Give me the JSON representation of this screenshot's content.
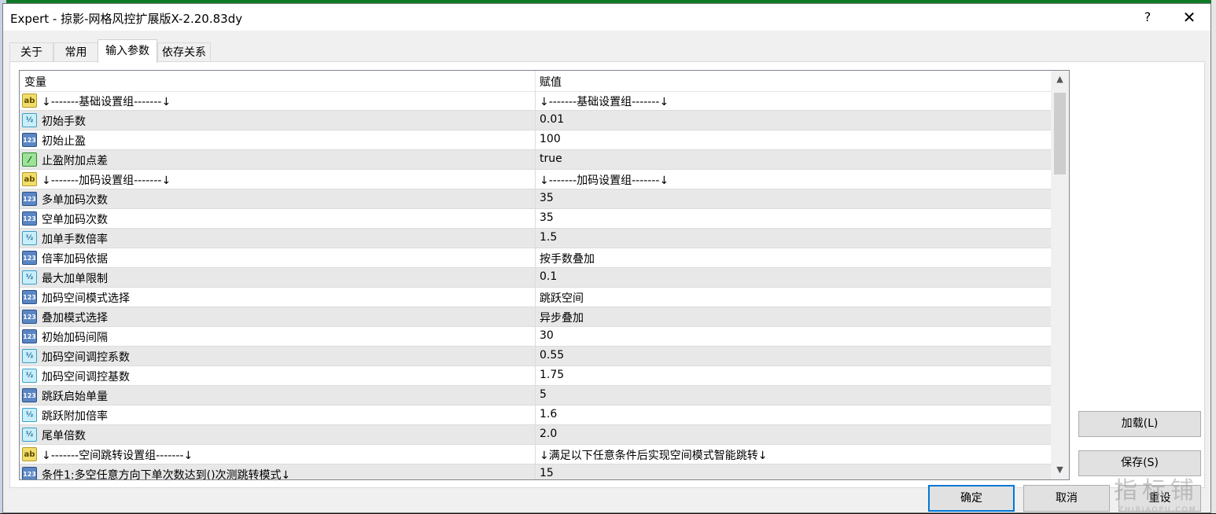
{
  "window": {
    "title": "Expert - 掠影-网格风控扩展版X-2.20.83dy",
    "help_label": "?",
    "close_label": "✕"
  },
  "tabs": [
    {
      "label": "关于"
    },
    {
      "label": "常用"
    },
    {
      "label": "输入参数"
    },
    {
      "label": "依存关系"
    }
  ],
  "active_tab": "输入参数",
  "grid": {
    "headers": {
      "variable": "变量",
      "value": "赋值"
    },
    "rows": [
      {
        "type": "ab",
        "variable": "↓-------基础设置组-------↓",
        "value": "↓-------基础设置组-------↓"
      },
      {
        "type": "½",
        "variable": "初始手数",
        "value": "0.01"
      },
      {
        "type": "123",
        "variable": "初始止盈",
        "value": "100"
      },
      {
        "type": "bool",
        "variable": "止盈附加点差",
        "value": "true"
      },
      {
        "type": "ab",
        "variable": "↓-------加码设置组-------↓",
        "value": "↓-------加码设置组-------↓"
      },
      {
        "type": "123",
        "variable": "多单加码次数",
        "value": "35"
      },
      {
        "type": "123",
        "variable": "空单加码次数",
        "value": "35"
      },
      {
        "type": "½",
        "variable": "加单手数倍率",
        "value": "1.5"
      },
      {
        "type": "123",
        "variable": "倍率加码依据",
        "value": "按手数叠加"
      },
      {
        "type": "½",
        "variable": "最大加单限制",
        "value": "0.1"
      },
      {
        "type": "123",
        "variable": "加码空间模式选择",
        "value": "跳跃空间"
      },
      {
        "type": "123",
        "variable": "叠加模式选择",
        "value": "异步叠加"
      },
      {
        "type": "123",
        "variable": "初始加码间隔",
        "value": "30"
      },
      {
        "type": "½",
        "variable": "加码空间调控系数",
        "value": "0.55"
      },
      {
        "type": "½",
        "variable": "加码空间调控基数",
        "value": "1.75"
      },
      {
        "type": "123",
        "variable": "跳跃启始单量",
        "value": "5"
      },
      {
        "type": "½",
        "variable": "跳跃附加倍率",
        "value": "1.6"
      },
      {
        "type": "½",
        "variable": "尾单倍数",
        "value": "2.0"
      },
      {
        "type": "ab",
        "variable": "↓-------空间跳转设置组-------↓",
        "value": "↓满足以下任意条件后实现空间模式智能跳转↓"
      },
      {
        "type": "123",
        "variable": "条件1:多空任意方向下单次数达到()次测跳转模式↓",
        "value": "15"
      }
    ]
  },
  "icon_glyphs": {
    "ab": "ab",
    "½": "½",
    "123": "123",
    "bool": "⁄"
  },
  "scroll": {
    "up": "▲",
    "down": "▼"
  },
  "buttons": {
    "load": "加载(L)",
    "save": "保存(S)",
    "ok": "确定",
    "cancel": "取消",
    "reset": "重设"
  },
  "watermark": {
    "cn": "指标铺",
    "en": "ZHIBIAOPU.COM"
  },
  "colors": {
    "accent": "#0078d7",
    "row_alt": "#e8e8e8",
    "dialog_bg": "#f0f0f0"
  }
}
